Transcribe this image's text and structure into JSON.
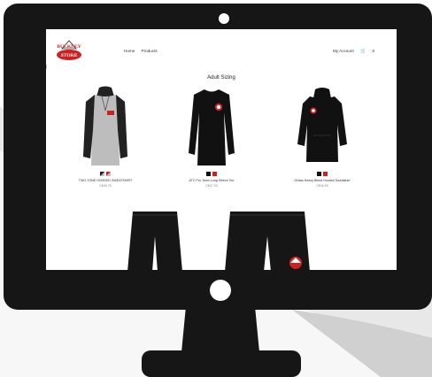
{
  "site": {
    "logo_top": "BULKLEY",
    "logo_bottom": "STORE",
    "nav_left": [
      "Home",
      "Products"
    ],
    "account_label": "My Account",
    "cart_count": "0",
    "breadcrumb_pipe": "|",
    "section_title": "Adult Sizing"
  },
  "products": [
    {
      "name": "TWO-TONE HOODED SWEATSHIRT",
      "price": "C$45.75",
      "swatches": [
        "#222222",
        "#d02020"
      ],
      "icon": "hoodie-two-tone"
    },
    {
      "name": "ATC Pro Team Long Sleeve Tee",
      "price": "C$27.93",
      "swatches": [
        "#111111",
        "#d02020"
      ],
      "icon": "long-sleeve-tee"
    },
    {
      "name": "Gildan Heavy Blend Hooded Sweatshirt",
      "price": "C$38.99",
      "swatches": [
        "#111111",
        "#d02020"
      ],
      "icon": "hoodie-black"
    }
  ],
  "bottom_products": [
    {
      "icon": "shorts"
    },
    {
      "icon": "sweatpants"
    }
  ],
  "colors": {
    "bezel": "#161616",
    "accent": "#d02020",
    "swoosh": "#c8c8c8"
  }
}
